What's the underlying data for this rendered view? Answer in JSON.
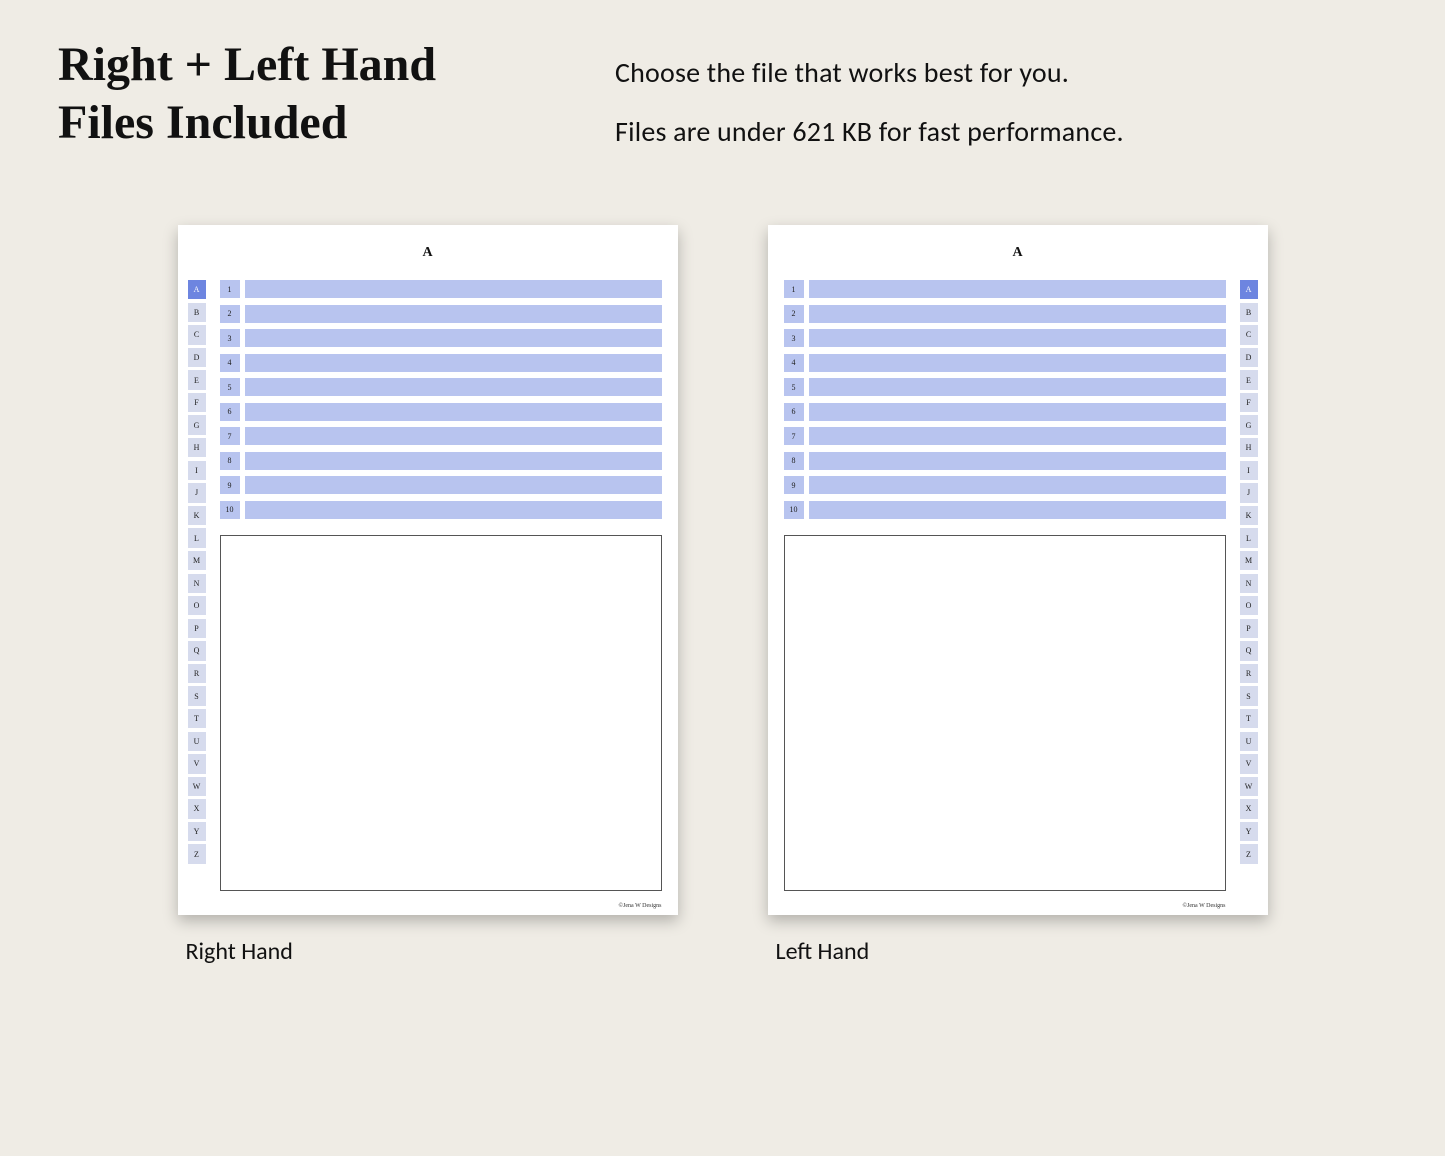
{
  "heading_line1": "Right + Left Hand",
  "heading_line2": "Files Included",
  "sub_line1": "Choose the file that works best for you.",
  "sub_line2": "Files are under 621 KB for fast performance.",
  "page_title": "A",
  "active_tab": "A",
  "tabs": [
    "A",
    "B",
    "C",
    "D",
    "E",
    "F",
    "G",
    "H",
    "I",
    "J",
    "K",
    "L",
    "M",
    "N",
    "O",
    "P",
    "Q",
    "R",
    "S",
    "T",
    "U",
    "V",
    "W",
    "X",
    "Y",
    "Z"
  ],
  "lines": [
    "1",
    "2",
    "3",
    "4",
    "5",
    "6",
    "7",
    "8",
    "9",
    "10"
  ],
  "footer_credit": "©Jena W Designs",
  "caption_right": "Right Hand",
  "caption_left": "Left Hand"
}
